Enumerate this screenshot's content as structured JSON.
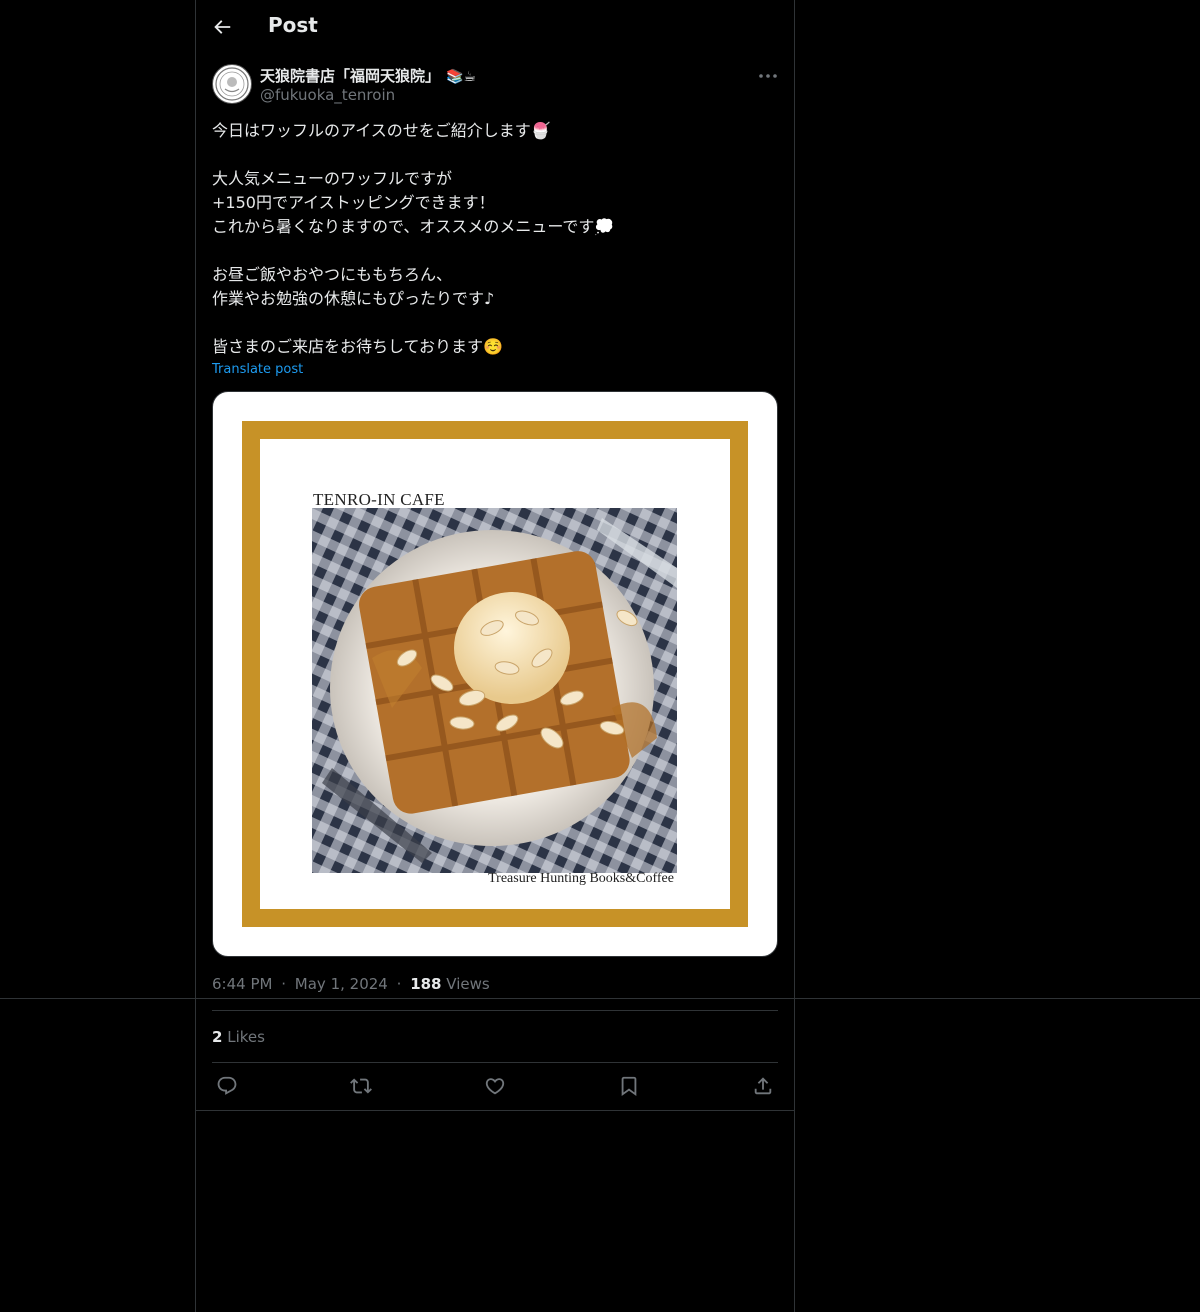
{
  "header": {
    "title": "Post"
  },
  "author": {
    "display_name": "天狼院書店「福岡天狼院」",
    "name_emojis": "📚☕",
    "handle": "@fukuoka_tenroin"
  },
  "post": {
    "lines": [
      "今日はワッフルのアイスのせをご紹介します🍧",
      "",
      "大人気メニューのワッフルですが",
      "+150円でアイストッピングできます！",
      "これから暑くなりますので、オススメのメニューです💭",
      "",
      "お昼ご飯やおやつにももちろん、",
      "作業やお勉強の休憩にもぴったりです♪",
      "",
      "皆さまのご来店をお待ちしております☺️"
    ],
    "translate_label": "Translate post"
  },
  "media": {
    "title": "TENRO-IN CAFE",
    "tagline": "Treasure Hunting Books&Coffee",
    "frame_color": "#c79227"
  },
  "meta": {
    "time": "6:44 PM",
    "date": "May 1, 2024",
    "views_count": "188",
    "views_label": "Views",
    "dot": "·"
  },
  "likes": {
    "count": "2",
    "label": "Likes"
  },
  "actions": [
    "reply-icon",
    "repost-icon",
    "like-icon",
    "bookmark-icon",
    "share-icon"
  ],
  "colors": {
    "background": "#000000",
    "text": "#e7e9ea",
    "muted": "#71767b",
    "link": "#1d9bf0",
    "border": "#2f3336"
  }
}
